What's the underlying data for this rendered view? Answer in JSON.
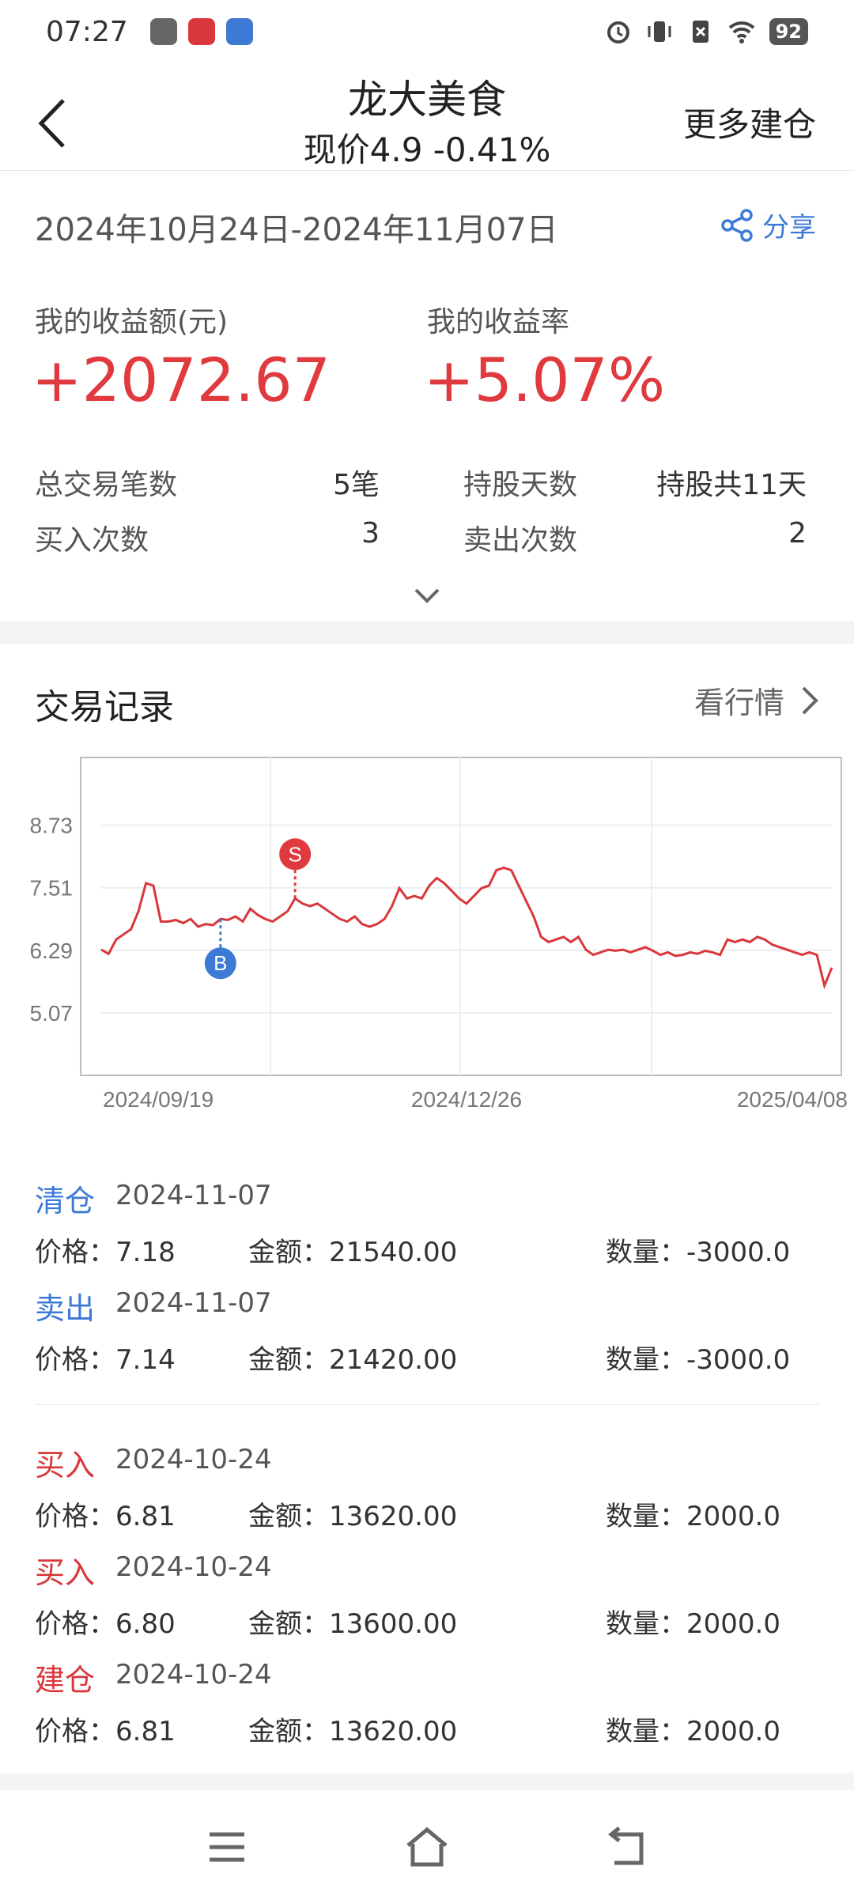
{
  "status": {
    "time": "07:27",
    "battery": "92"
  },
  "header": {
    "title": "龙大美食",
    "subtitle": "现价4.9 -0.41%",
    "more": "更多建仓"
  },
  "summary": {
    "date_range": "2024年10月24日-2024年11月07日",
    "share": "分享",
    "profit_label": "我的收益额(元)",
    "profit_value": "+2072.67",
    "rate_label": "我的收益率",
    "rate_value": "+5.07%",
    "stats": [
      {
        "label": "总交易笔数",
        "value": "5笔"
      },
      {
        "label": "持股天数",
        "value": "持股共11天"
      },
      {
        "label": "买入次数",
        "value": "3"
      },
      {
        "label": "卖出次数",
        "value": "2"
      }
    ]
  },
  "section": {
    "title": "交易记录",
    "link": "看行情"
  },
  "chart_data": {
    "type": "line",
    "y_ticks": [
      "8.73",
      "7.51",
      "6.29",
      "5.07"
    ],
    "x_ticks": [
      "2024/09/19",
      "2024/12/26",
      "2025/04/08"
    ],
    "ylim": [
      3.85,
      10.05
    ],
    "grid": true,
    "line_color": "#d9373c",
    "markers": [
      {
        "label": "B",
        "color": "#3d7ad6",
        "index": 16
      },
      {
        "label": "S",
        "color": "#e0393e",
        "index": 26
      }
    ],
    "values": [
      6.3,
      6.22,
      6.5,
      6.6,
      6.7,
      7.05,
      7.6,
      7.55,
      6.85,
      6.85,
      6.88,
      6.82,
      6.9,
      6.75,
      6.8,
      6.78,
      6.9,
      6.88,
      6.95,
      6.85,
      7.1,
      6.98,
      6.9,
      6.85,
      6.95,
      7.05,
      7.3,
      7.2,
      7.15,
      7.2,
      7.1,
      7.0,
      6.9,
      6.85,
      6.95,
      6.8,
      6.75,
      6.8,
      6.9,
      7.15,
      7.5,
      7.3,
      7.35,
      7.3,
      7.55,
      7.7,
      7.6,
      7.45,
      7.3,
      7.2,
      7.35,
      7.5,
      7.55,
      7.85,
      7.9,
      7.85,
      7.55,
      7.25,
      6.95,
      6.55,
      6.45,
      6.5,
      6.55,
      6.45,
      6.55,
      6.3,
      6.2,
      6.25,
      6.3,
      6.28,
      6.3,
      6.25,
      6.3,
      6.35,
      6.28,
      6.2,
      6.25,
      6.18,
      6.2,
      6.25,
      6.22,
      6.28,
      6.25,
      6.2,
      6.5,
      6.45,
      6.5,
      6.45,
      6.55,
      6.5,
      6.4,
      6.35,
      6.3,
      6.25,
      6.2,
      6.25,
      6.2,
      5.6,
      5.95
    ]
  },
  "records": [
    {
      "type": "清仓",
      "kind": "sell",
      "date": "2024-11-07",
      "price": "价格：7.18",
      "amount": "金额：21540.00",
      "qty": "数量：-3000.0"
    },
    {
      "type": "卖出",
      "kind": "sell",
      "date": "2024-11-07",
      "price": "价格：7.14",
      "amount": "金额：21420.00",
      "qty": "数量：-3000.0"
    },
    {
      "type": "买入",
      "kind": "buy",
      "date": "2024-10-24",
      "price": "价格：6.81",
      "amount": "金额：13620.00",
      "qty": "数量：2000.0"
    },
    {
      "type": "买入",
      "kind": "buy",
      "date": "2024-10-24",
      "price": "价格：6.80",
      "amount": "金额：13600.00",
      "qty": "数量：2000.0"
    },
    {
      "type": "建仓",
      "kind": "buy",
      "date": "2024-10-24",
      "price": "价格：6.81",
      "amount": "金额：13620.00",
      "qty": "数量：2000.0"
    }
  ],
  "icons": {
    "back": "chevron-left-icon",
    "share": "share-icon",
    "expand": "chevron-down-icon",
    "link": "chevron-right-icon",
    "nav": [
      "menu-icon",
      "home-icon",
      "back-icon"
    ]
  }
}
